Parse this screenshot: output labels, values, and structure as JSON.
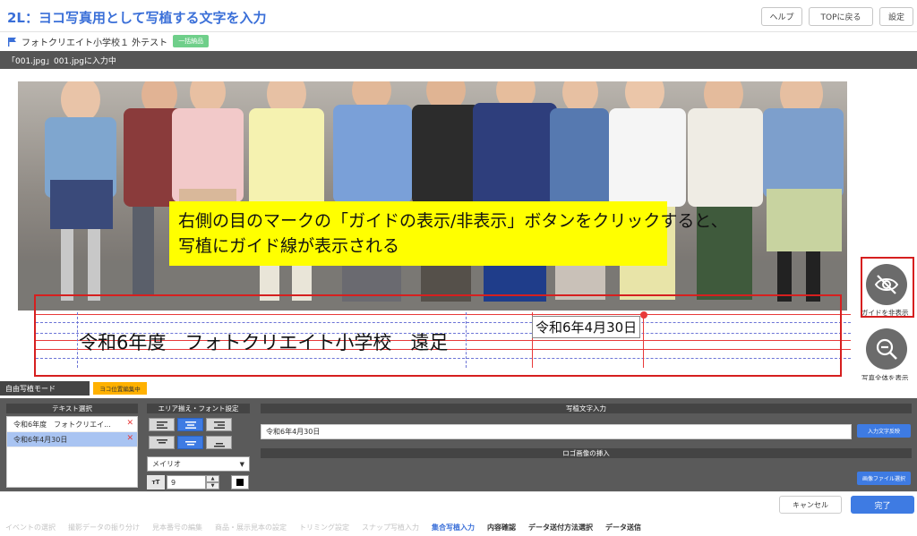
{
  "header": {
    "title": "2L：ヨコ写真用として写植する文字を入力",
    "help_label": "ヘルプ",
    "top_label": "TOPに戻る",
    "settings_label": "設定"
  },
  "project": {
    "name": "フォトクリエイト小学校１ 外テスト",
    "badge": "一括納品"
  },
  "file_status": "「001.jpg」001.jpgに入力中",
  "annotation": {
    "line1": "右側の目のマークの「ガイドの表示/非表示」ボタンをクリックすると、",
    "line2": "写植にガイド線が表示される"
  },
  "typeset": {
    "text1": "令和6年度　フォトクリエイト小学校　遠足",
    "text2": "令和6年4月30日"
  },
  "side_buttons": {
    "guide_label": "ガイドを非表示",
    "fit_label": "写真全体を表示",
    "guide_icon": "eye-slash-icon",
    "fit_icon": "zoom-out-icon"
  },
  "mode": {
    "label": "自由写植モード",
    "badge": "ヨコ位置編集中"
  },
  "panel": {
    "text_select_header": "テキスト選択",
    "text_items": [
      "令和6年度　フォトクリエイ...",
      "令和6年4月30日"
    ],
    "align_header": "エリア揃え・フォント設定",
    "font": "メイリオ",
    "font_size": "9",
    "input_header": "写植文字入力",
    "input_value": "令和6年4月30日",
    "apply_label": "入力文字反映",
    "logo_header": "ロゴ画像の挿入",
    "file_select_label": "画像ファイル選択"
  },
  "footer": {
    "cancel_label": "キャンセル",
    "done_label": "完了"
  },
  "steps": [
    "イベントの選択",
    "撮影データの振り分け",
    "見本番号の編集",
    "商品・展示見本の設定",
    "トリミング設定",
    "スナップ写植入力",
    "集合写植入力",
    "内容確認",
    "データ送付方法選択",
    "データ送信"
  ],
  "colors": {
    "accent": "#3e7be3",
    "highlight": "#d61f1f",
    "callout_bg": "#ffff00",
    "guide_red": "#e83a3a",
    "guide_blue": "#6c74d6"
  }
}
